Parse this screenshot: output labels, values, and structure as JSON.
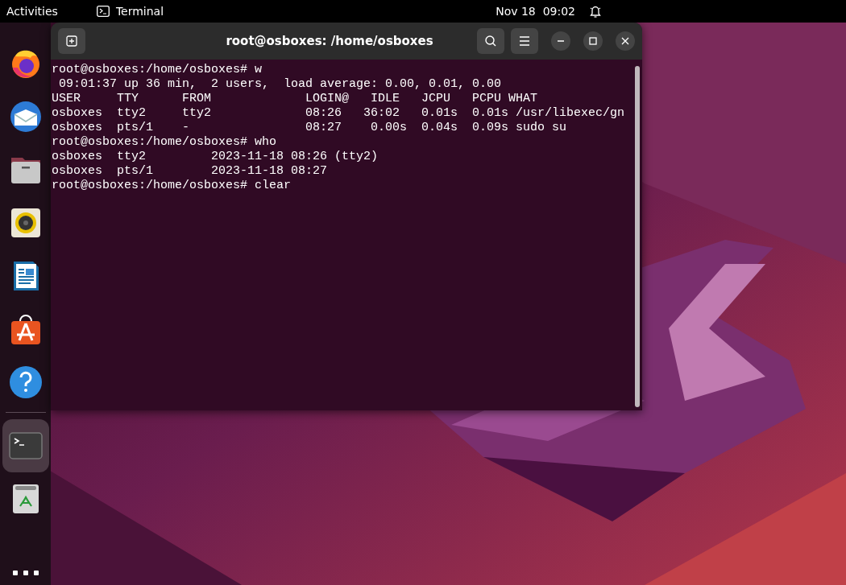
{
  "top_bar": {
    "activities": "Activities",
    "app_menu": "Terminal",
    "date": "Nov 18",
    "time": "09:02"
  },
  "dock": {
    "items": [
      {
        "kind": "browser",
        "selected": false
      },
      {
        "kind": "mail",
        "selected": false
      },
      {
        "kind": "files",
        "selected": false
      },
      {
        "kind": "music",
        "selected": false
      },
      {
        "kind": "writer",
        "selected": false
      },
      {
        "kind": "store",
        "selected": false
      },
      {
        "kind": "help",
        "selected": false
      },
      {
        "kind": "separator"
      },
      {
        "kind": "terminal",
        "selected": true
      },
      {
        "kind": "trash",
        "selected": false
      }
    ]
  },
  "window": {
    "title": "root@osboxes: /home/osboxes",
    "lines": [
      "root@osboxes:/home/osboxes# w",
      " 09:01:37 up 36 min,  2 users,  load average: 0.00, 0.01, 0.00",
      "USER     TTY      FROM             LOGIN@   IDLE   JCPU   PCPU WHAT",
      "osboxes  tty2     tty2             08:26   36:02   0.01s  0.01s /usr/libexec/gn",
      "osboxes  pts/1    -                08:27    0.00s  0.04s  0.09s sudo su",
      "root@osboxes:/home/osboxes# who",
      "osboxes  tty2         2023-11-18 08:26 (tty2)",
      "osboxes  pts/1        2023-11-18 08:27",
      "root@osboxes:/home/osboxes# clear"
    ]
  }
}
